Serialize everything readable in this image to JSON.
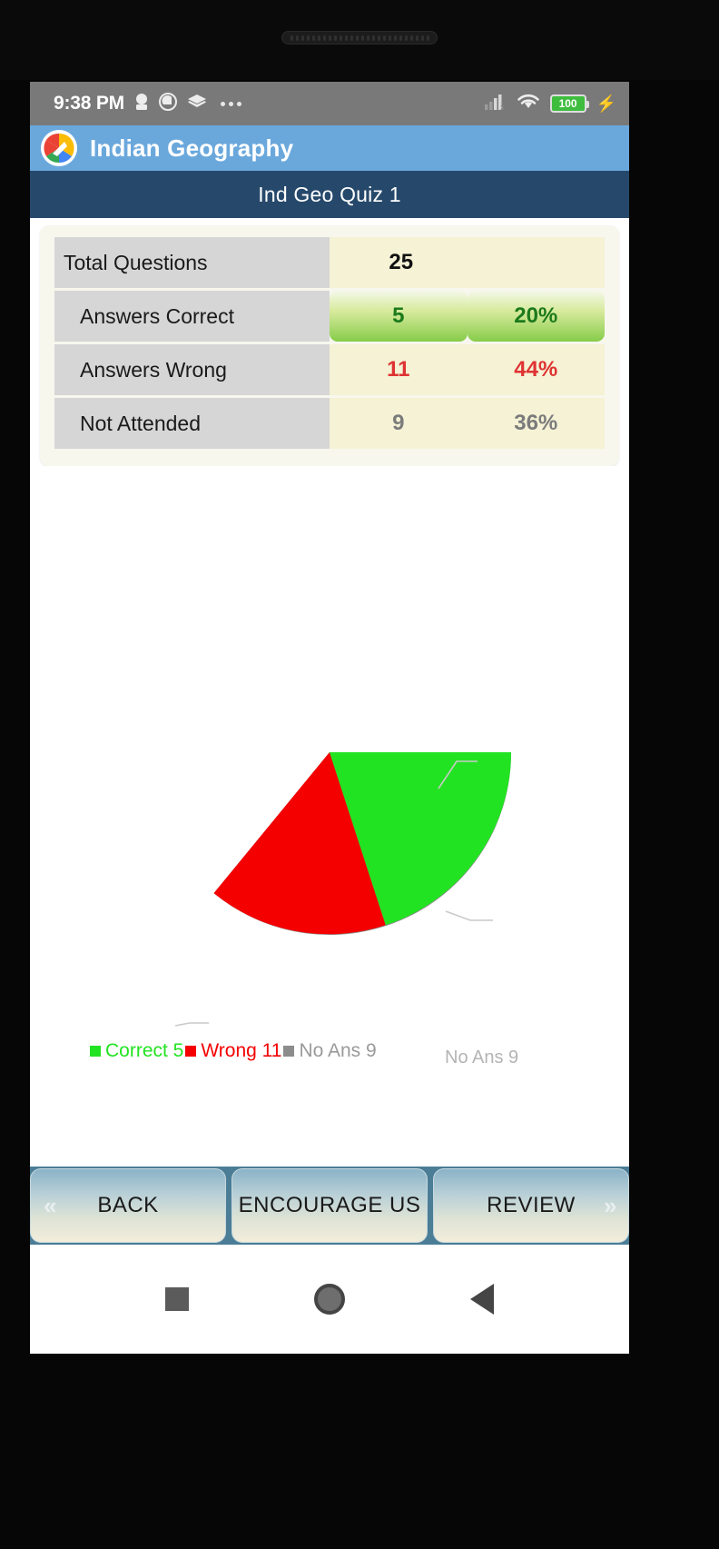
{
  "status_bar": {
    "time": "9:38 PM",
    "icons": [
      "user-icon",
      "record-icon",
      "layers-icon",
      "more-dots-icon"
    ],
    "signal_icon": "cellular-signal-icon",
    "wifi_icon": "wifi-icon",
    "battery_level": "100",
    "charging_icon": "charging-bolt-icon"
  },
  "title_bar": {
    "app_icon": "app-logo-icon",
    "title": "Indian Geography"
  },
  "subtitle_bar": {
    "text": "Ind Geo Quiz 1"
  },
  "summary": {
    "rows": [
      {
        "label": "Total Questions",
        "value": "25",
        "percent": "",
        "style": "black"
      },
      {
        "label": "Answers Correct",
        "value": "5",
        "percent": "20%",
        "style": "green"
      },
      {
        "label": "Answers Wrong",
        "value": "11",
        "percent": "44%",
        "style": "red"
      },
      {
        "label": "Not Attended",
        "value": "9",
        "percent": "36%",
        "style": "gray"
      }
    ]
  },
  "chart_data": {
    "type": "pie",
    "title": "",
    "categories": [
      "Correct",
      "Wrong",
      "No Ans"
    ],
    "values": [
      5,
      11,
      9
    ],
    "percent": [
      20,
      44,
      36
    ],
    "colors": [
      "#22e322",
      "#f40000",
      "#8c8c8c"
    ],
    "labels": [
      "Correct 5",
      "Wrong 11",
      "No Ans 9"
    ],
    "legend_position": "bottom-left",
    "grid": false,
    "label_color": "#b4b4b4",
    "label_noans": "No Ans 9",
    "label_wrong": "Wrong 11",
    "label_correct": "Correct 5"
  },
  "legend": {
    "correct": "Correct 5",
    "wrong": "Wrong 11",
    "noans": "No Ans 9"
  },
  "buttons": {
    "back": "BACK",
    "back_chevron": "«",
    "encourage": "ENCOURAGE US",
    "review": "REVIEW",
    "review_chevron": "»"
  },
  "nav_bar": {
    "recents": "square-recents-icon",
    "home": "circle-home-icon",
    "back": "triangle-back-icon"
  }
}
